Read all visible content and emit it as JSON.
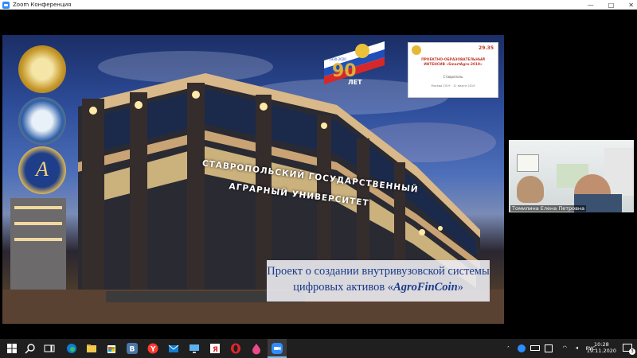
{
  "window": {
    "title": "Zoom Конференция",
    "controls": {
      "minimize": "—",
      "maximize": "□",
      "close": "✕"
    }
  },
  "slide": {
    "building_sign_line1": "СТАВРОПОЛЬСКИЙ ГОСУДАРСТВЕННЫЙ",
    "building_sign_line2": "АГРАРНЫЙ УНИВЕРСИТЕТ",
    "banner_line1": "Проект о создании внутривузовской системы",
    "banner_line2_prefix": "цифровых активов «",
    "banner_line2_italic": "AgroFinCoin",
    "banner_line2_suffix": "»",
    "badge_years": "1930-2020",
    "badge_number": "90",
    "badge_word": "ЛЕТ",
    "poster_number": "29.35",
    "poster_title": "ПРОЕКТНО-ОБРАЗОВАТЕЛЬНЫЙ ИНТЕНСИВ «SmartAgro-2019»",
    "poster_city": "Ставрополь",
    "poster_dates": "Москва 2019 · 11 марта 2019"
  },
  "video_tile": {
    "participant_name": "Томилина Елена Петровна"
  },
  "taskbar": {
    "lang": "РУС",
    "time": "10:28",
    "date": "19.11.2020",
    "notification_count": "3",
    "colors": {
      "zoom": "#2d8cff",
      "edge": "#0f7dd6",
      "yandex": "#ff3b30",
      "opera": "#e0252b",
      "vk": "#4a76a8"
    }
  }
}
